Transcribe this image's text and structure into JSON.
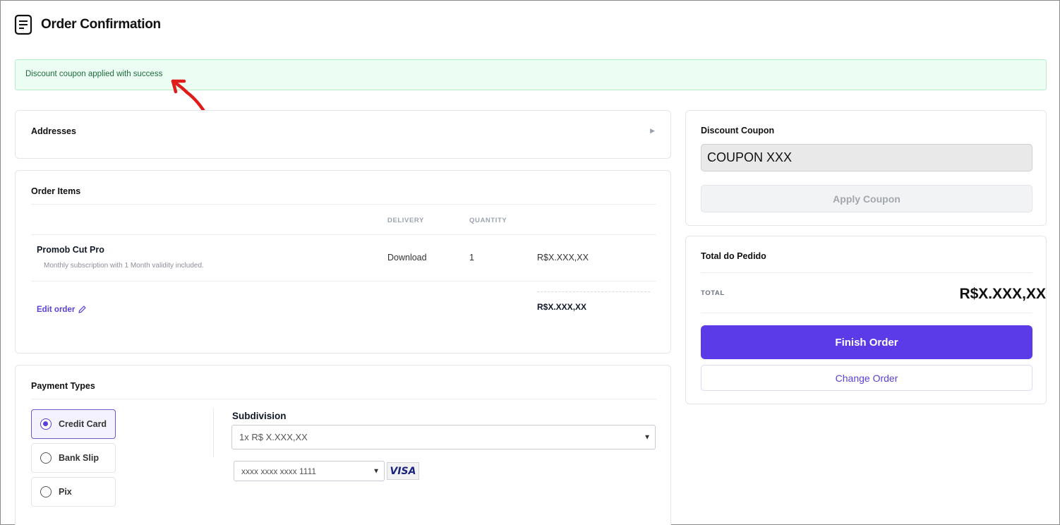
{
  "header": {
    "title": "Order Confirmation",
    "icon": "document-icon"
  },
  "alert": {
    "message": "Discount coupon applied with success",
    "color": "#1e6b3a"
  },
  "addresses": {
    "title": "Addresses",
    "toggle_icon": "caret-right-icon"
  },
  "order_items": {
    "title": "Order Items",
    "columns": [
      "DELIVERY",
      "QUANTITY"
    ],
    "rows": [
      {
        "name": "Promob Cut Pro",
        "description": "Monthly subscription with 1 Month validity included.",
        "delivery": "Download",
        "quantity": "1",
        "price": "R$X.XXX,XX"
      }
    ],
    "edit_label": "Edit order",
    "subtotal": "R$X.XXX,XX"
  },
  "payment": {
    "title": "Payment Types",
    "options": [
      {
        "label": "Credit Card",
        "selected": true
      },
      {
        "label": "Bank Slip",
        "selected": false
      },
      {
        "label": "Pix",
        "selected": false
      }
    ],
    "subdivision_label": "Subdivision",
    "subdivision_value": "1x R$ X.XXX,XX",
    "card_value": "xxxx xxxx xxxx 1111",
    "card_brand": "VISA"
  },
  "coupon": {
    "title": "Discount Coupon",
    "value": "COUPON XXX",
    "apply_label": "Apply Coupon"
  },
  "total": {
    "title": "Total do Pedido",
    "label": "TOTAL",
    "value": "R$X.XXX,XX",
    "finish_label": "Finish Order",
    "change_label": "Change Order",
    "accent": "#5b3ae8"
  }
}
